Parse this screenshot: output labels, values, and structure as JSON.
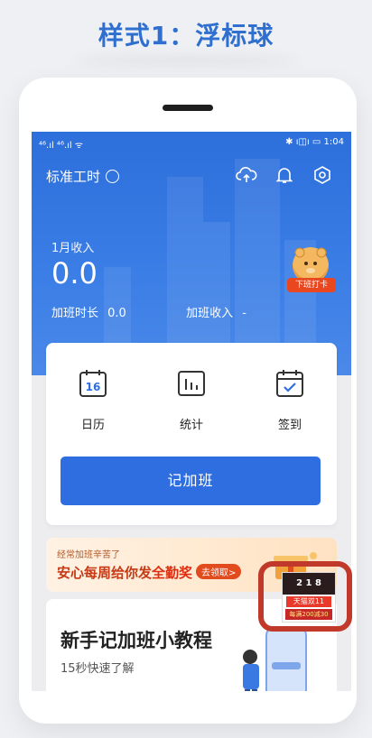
{
  "page": {
    "title": "样式1：浮标球"
  },
  "status_bar": {
    "left": "⁴⁶.ıl ⁴⁶.ıl ᯤ",
    "right": "✱ ı◫ı ▭ 1:04"
  },
  "header": {
    "mode_label": "标准工时"
  },
  "summary": {
    "month_label": "1月收入",
    "income": "0.0",
    "overtime_hours_label": "加班时长",
    "overtime_hours": "0.0",
    "overtime_income_label": "加班收入",
    "overtime_income": "-"
  },
  "clock_button": {
    "label": "下班打卡"
  },
  "tools": [
    {
      "label": "日历",
      "icon": "calendar-icon",
      "badge": "16"
    },
    {
      "label": "统计",
      "icon": "stats-icon"
    },
    {
      "label": "签到",
      "icon": "checkin-icon"
    }
  ],
  "primary_button": {
    "label": "记加班"
  },
  "banner": {
    "subtitle": "经常加班辛苦了",
    "title": "安心每周给你发",
    "highlight": "全勤奖",
    "cta": "去领取>"
  },
  "tutorial": {
    "title": "新手记加班小教程",
    "subtitle": "15秒快速了解"
  },
  "float_ad": {
    "top": "2 1 8",
    "mid": "天猫双11",
    "bottom": "每满200减30"
  },
  "colors": {
    "brand_blue": "#2e6ee0",
    "title_blue": "#2f6fd0",
    "highlight_border": "#c0392b",
    "banner_red": "#c63b16"
  }
}
